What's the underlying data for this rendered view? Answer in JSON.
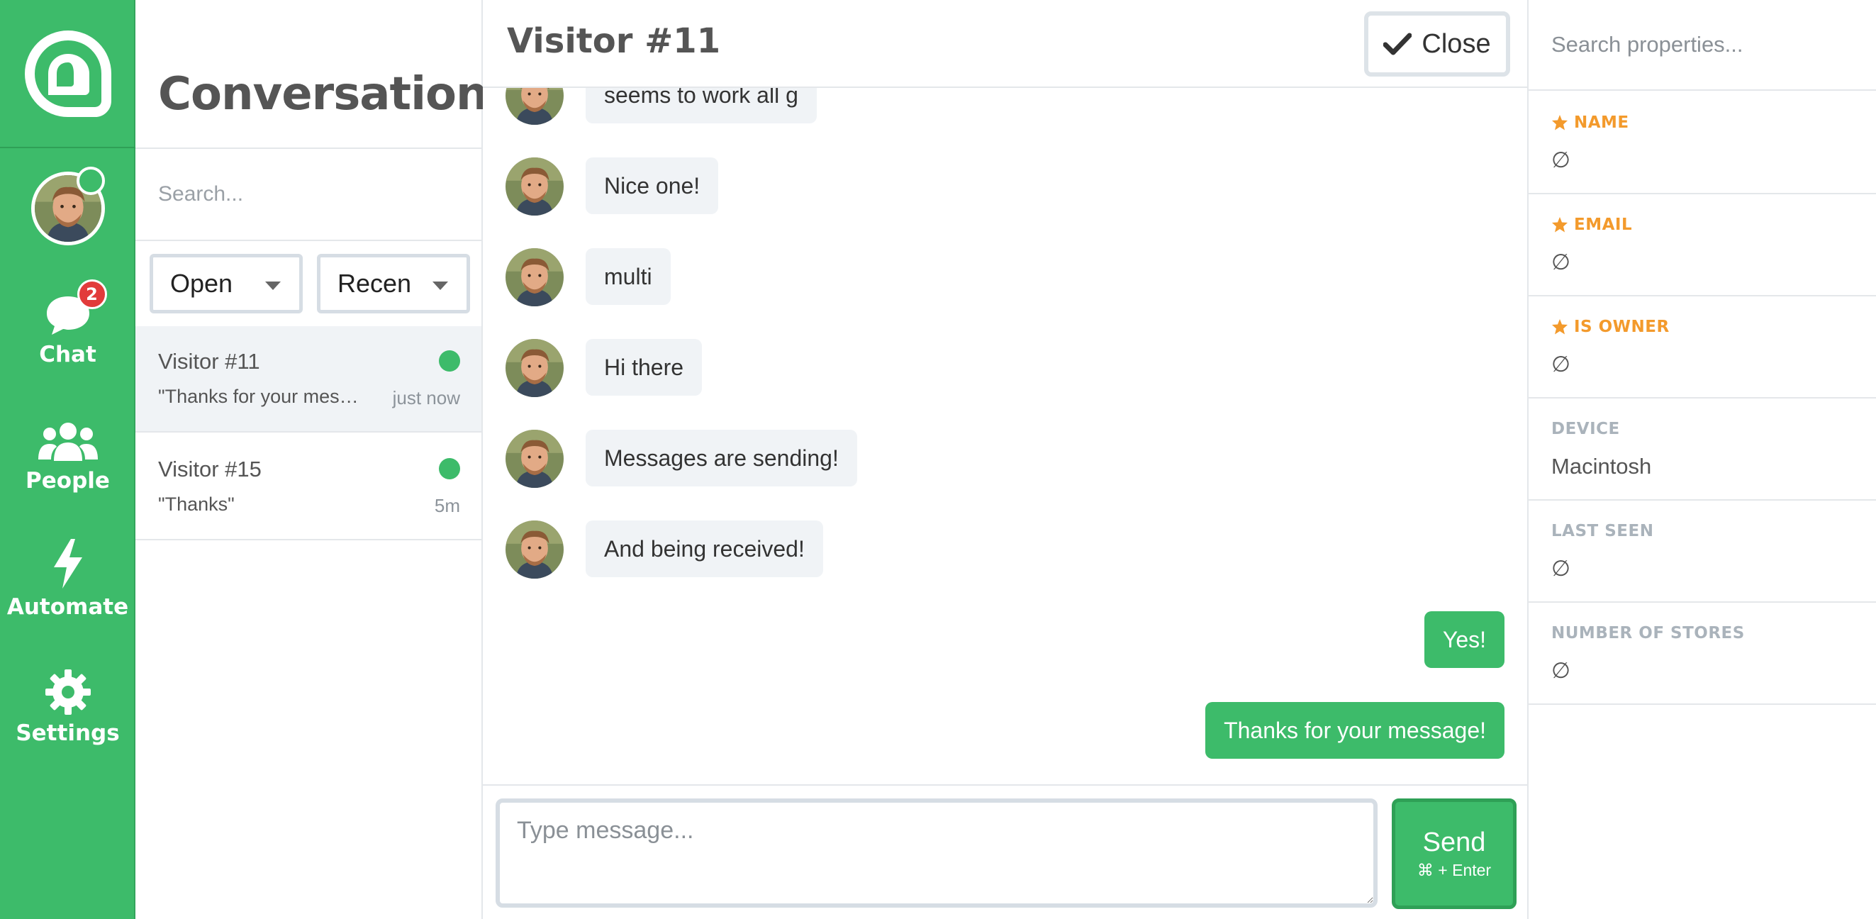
{
  "nav": {
    "items": [
      {
        "label": "Chat",
        "badge": "2",
        "icon": "chat-bubble-icon"
      },
      {
        "label": "People",
        "icon": "people-icon"
      },
      {
        "label": "Automate",
        "icon": "lightning-icon"
      },
      {
        "label": "Settings",
        "icon": "gear-icon"
      }
    ]
  },
  "conversations": {
    "title": "Conversations",
    "search_placeholder": "Search...",
    "filter_status": "Open",
    "filter_sort": "Recen",
    "items": [
      {
        "name": "Visitor #11",
        "preview": "\"Thanks for your message!\"",
        "time": "just now",
        "online": true
      },
      {
        "name": "Visitor #15",
        "preview": "\"Thanks\"",
        "time": "5m",
        "online": true
      }
    ]
  },
  "chat": {
    "title": "Visitor #11",
    "close_label": "Close",
    "messages": [
      {
        "text": "seems to work all g",
        "mine": false
      },
      {
        "text": "Nice one!",
        "mine": false
      },
      {
        "text": "multi",
        "mine": false
      },
      {
        "text": "Hi there",
        "mine": false
      },
      {
        "text": "Messages are sending!",
        "mine": false
      },
      {
        "text": "And being received!",
        "mine": false
      },
      {
        "text": "Yes!",
        "mine": true
      },
      {
        "text": "Thanks for your message!",
        "mine": true
      }
    ],
    "composer_placeholder": "Type message...",
    "send_label": "Send",
    "send_hint": "⌘ + Enter"
  },
  "properties": {
    "search_placeholder": "Search properties...",
    "items": [
      {
        "key": "NAME",
        "value": "∅",
        "starred": true
      },
      {
        "key": "EMAIL",
        "value": "∅",
        "starred": true
      },
      {
        "key": "IS OWNER",
        "value": "∅",
        "starred": true
      },
      {
        "key": "DEVICE",
        "value": "Macintosh",
        "starred": false
      },
      {
        "key": "LAST SEEN",
        "value": "∅",
        "starred": false
      },
      {
        "key": "NUMBER OF STORES",
        "value": "∅",
        "starred": false
      }
    ]
  },
  "colors": {
    "brand": "#3dbb6a",
    "star": "#f39a2c",
    "badge": "#e23b3b"
  }
}
